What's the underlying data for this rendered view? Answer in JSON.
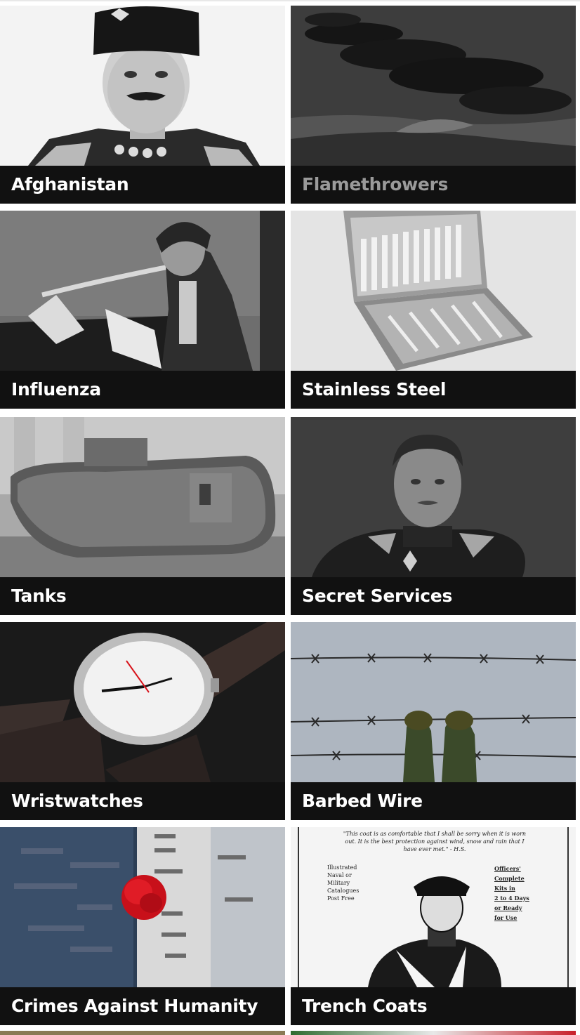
{
  "tiles": [
    {
      "label": "Afghanistan",
      "image": "portrait of man in fez and uniform"
    },
    {
      "label": "Flamethrowers",
      "image": "smoke over battlefield"
    },
    {
      "label": "Influenza",
      "image": "woman with breathing apparatus"
    },
    {
      "label": "Stainless Steel",
      "image": "cutlery set in case"
    },
    {
      "label": "Tanks",
      "image": "ww1 tank"
    },
    {
      "label": "Secret Services",
      "image": "portrait of officer"
    },
    {
      "label": "Wristwatches",
      "image": "wristwatch"
    },
    {
      "label": "Barbed Wire",
      "image": "hands on barbed wire"
    },
    {
      "label": "Crimes Against Humanity",
      "image": "memorial wall with red flower"
    },
    {
      "label": "Trench Coats",
      "image": "trench coat advertisement"
    }
  ],
  "trench_ad": {
    "quote": "\"This coat is as comfortable that I shall be sorry when it is worn out. It is the best protection against wind, snow and rain that I have ever met.\" - H.S.",
    "left_lines": [
      "Illustrated",
      "Naval or",
      "Military",
      "Catalogues",
      "Post Free"
    ],
    "right_lines": [
      "Officers'",
      "Complete",
      "Kits in",
      "2 to 4 Days",
      "or Ready",
      "for Use"
    ]
  },
  "colors": {
    "caption_bg": "#111111",
    "caption_text": "#ffffff",
    "caption_text_dim": "#9a9a9a",
    "flower_red": "#d8141c"
  }
}
